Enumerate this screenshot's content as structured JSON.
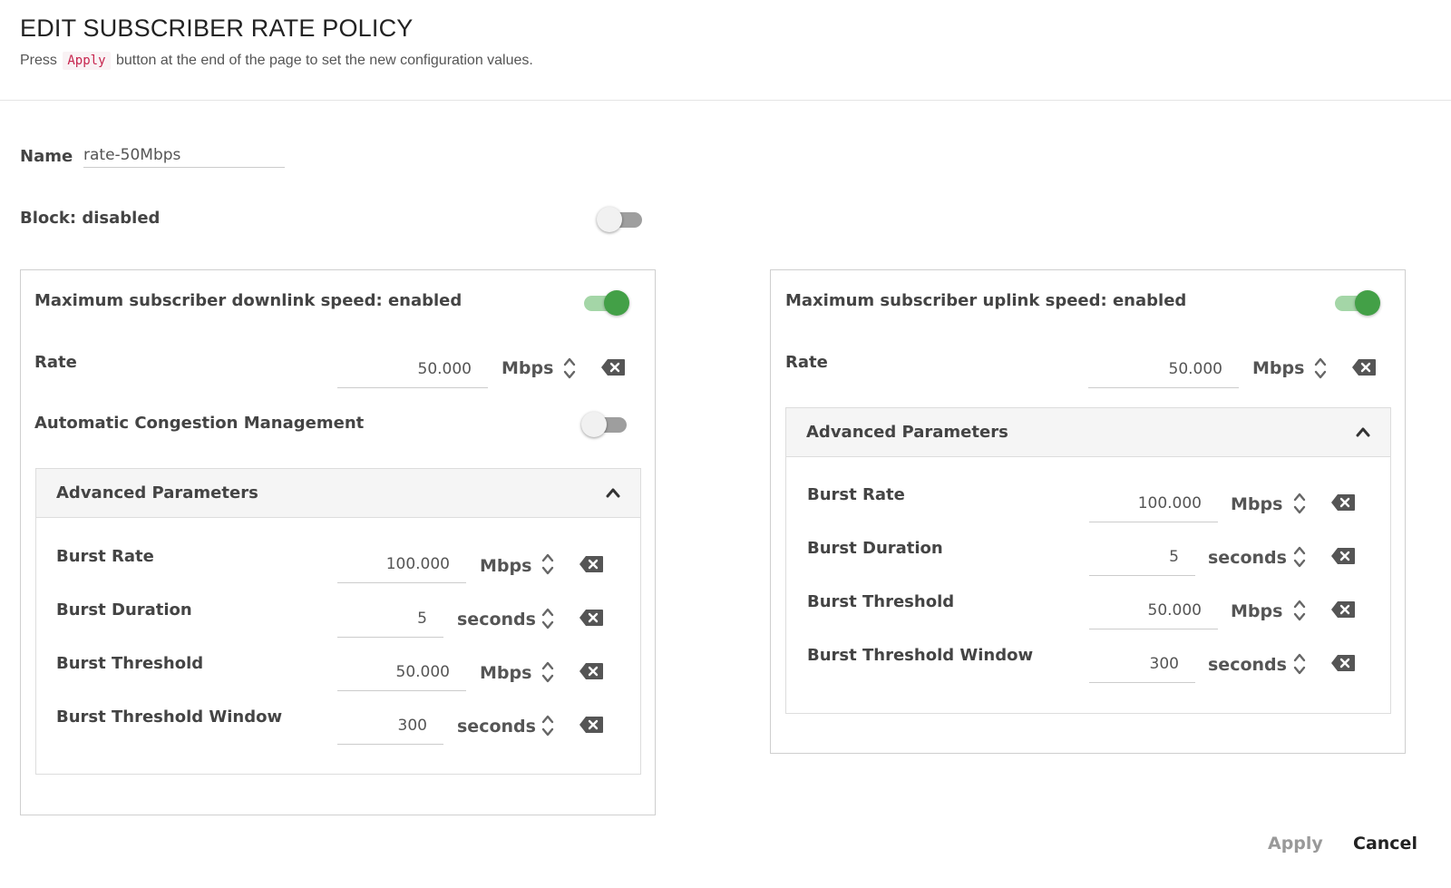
{
  "header": {
    "title": "EDIT SUBSCRIBER RATE POLICY",
    "subtitle_before": "Press",
    "subtitle_code": "Apply",
    "subtitle_after": "button at the end of the page to set the new configuration values."
  },
  "name": {
    "label": "Name",
    "value": "rate-50Mbps"
  },
  "block": {
    "label": "Block: disabled",
    "enabled": false
  },
  "downlink": {
    "title": "Maximum subscriber downlink speed: enabled",
    "enabled": true,
    "rate": {
      "label": "Rate",
      "value": "50.000",
      "unit": "Mbps"
    },
    "congestion": {
      "label": "Automatic Congestion Management",
      "enabled": false
    },
    "advanced": {
      "title": "Advanced Parameters",
      "burst_rate": {
        "label": "Burst Rate",
        "value": "100.000",
        "unit": "Mbps"
      },
      "burst_duration": {
        "label": "Burst Duration",
        "value": "5",
        "unit": "seconds"
      },
      "burst_threshold": {
        "label": "Burst Threshold",
        "value": "50.000",
        "unit": "Mbps"
      },
      "burst_threshold_window": {
        "label": "Burst Threshold Window",
        "value": "300",
        "unit": "seconds"
      }
    }
  },
  "uplink": {
    "title": "Maximum subscriber uplink speed: enabled",
    "enabled": true,
    "rate": {
      "label": "Rate",
      "value": "50.000",
      "unit": "Mbps"
    },
    "advanced": {
      "title": "Advanced Parameters",
      "burst_rate": {
        "label": "Burst Rate",
        "value": "100.000",
        "unit": "Mbps"
      },
      "burst_duration": {
        "label": "Burst Duration",
        "value": "5",
        "unit": "seconds"
      },
      "burst_threshold": {
        "label": "Burst Threshold",
        "value": "50.000",
        "unit": "Mbps"
      },
      "burst_threshold_window": {
        "label": "Burst Threshold Window",
        "value": "300",
        "unit": "seconds"
      }
    }
  },
  "footer": {
    "apply_label": "Apply",
    "cancel_label": "Cancel"
  },
  "colors": {
    "toggle_on": "#43a047",
    "toggle_on_track": "#a4d6a7",
    "toggle_off_track": "#9e9e9e",
    "code_text": "#c7254e"
  },
  "icons": {
    "spinner": "up-down-chevron-icon",
    "clear": "backspace-clear-icon",
    "collapse": "chevron-up-icon"
  }
}
